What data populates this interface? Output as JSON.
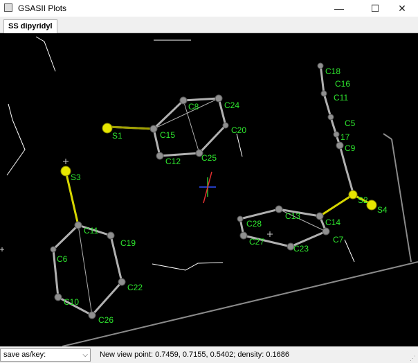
{
  "window": {
    "title": "GSASII Plots",
    "minimize_glyph": "—",
    "maximize_glyph": "☐",
    "close_glyph": "✕"
  },
  "tabs": [
    {
      "label": "SS dipyridyl",
      "active": true
    }
  ],
  "molecule": {
    "atoms": [
      {
        "name": "C18"
      },
      {
        "name": "C16"
      },
      {
        "name": "C11"
      },
      {
        "name": "C5"
      },
      {
        "name": "17"
      },
      {
        "name": "C9"
      },
      {
        "name": "C8"
      },
      {
        "name": "C24"
      },
      {
        "name": "C20"
      },
      {
        "name": "S1"
      },
      {
        "name": "C15"
      },
      {
        "name": "C12"
      },
      {
        "name": "C25"
      },
      {
        "name": "S3"
      },
      {
        "name": "C11"
      },
      {
        "name": "C19"
      },
      {
        "name": "C6"
      },
      {
        "name": "C10"
      },
      {
        "name": "C22"
      },
      {
        "name": "C26"
      },
      {
        "name": "S2"
      },
      {
        "name": "S4"
      },
      {
        "name": "C13"
      },
      {
        "name": "C14"
      },
      {
        "name": "C28"
      },
      {
        "name": "C27"
      },
      {
        "name": "C23"
      },
      {
        "name": "C7"
      }
    ],
    "colors": {
      "background": "#000000",
      "carbon": "#808080",
      "sulfur": "#e6e600",
      "bond": "#b0b0b0",
      "label": "#2ee62e",
      "cell_edge": "#ffffff"
    }
  },
  "status": {
    "key_select": "save as/key:",
    "view_text": "New view point: 0.7459, 0.7155, 0.5402; density: 0.1686"
  }
}
